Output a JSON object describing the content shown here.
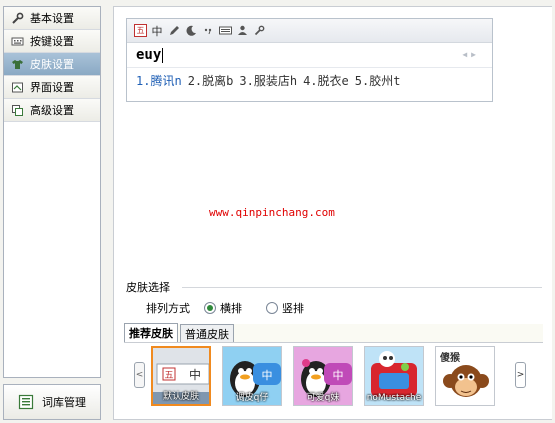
{
  "sidebar": {
    "items": [
      {
        "label": "基本设置",
        "icon": "wrench-icon"
      },
      {
        "label": "按键设置",
        "icon": "keyboard-icon"
      },
      {
        "label": "皮肤设置",
        "icon": "shirt-icon",
        "active": true
      },
      {
        "label": "界面设置",
        "icon": "window-icon"
      },
      {
        "label": "高级设置",
        "icon": "copy-icon"
      }
    ],
    "dict_button": {
      "label": "词库管理",
      "icon": "dictionary-icon"
    }
  },
  "ime_preview": {
    "logo": "五",
    "toolbar_mode": "中",
    "input": "euy",
    "candidates": [
      "1.腾讯n",
      "2.脱离b",
      "3.服装店h",
      "4.脱衣e",
      "5.胶州t"
    ]
  },
  "watermark": "www.qinpinchang.com",
  "skin_section": {
    "title": "皮肤选择",
    "arrange_label": "排列方式",
    "options": [
      {
        "label": "横排",
        "checked": true
      },
      {
        "label": "竖排",
        "checked": false
      }
    ],
    "tabs": [
      "推荐皮肤",
      "普通皮肤"
    ],
    "skins": [
      {
        "caption": "默认皮肤",
        "selected": true
      },
      {
        "caption": "调皮q仔"
      },
      {
        "caption": "可爱q妹"
      },
      {
        "caption": "noMustache"
      },
      {
        "caption": "傻猴"
      }
    ]
  },
  "colors": {
    "active_nav": "#9bb6cf",
    "watermark": "#e00000",
    "candidate_highlight": "#1f5fb5",
    "selected_border": "#f08a1f"
  }
}
